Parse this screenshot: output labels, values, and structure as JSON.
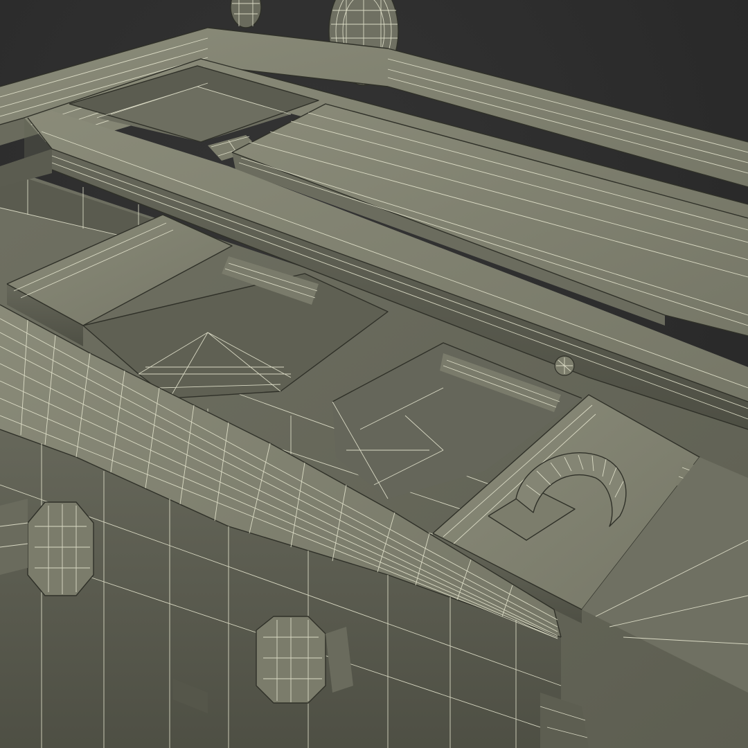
{
  "scene": {
    "background_color": "#2d2d2d",
    "mesh_color": "#7b7b6b",
    "mesh_shadow_color": "#55564a",
    "mesh_highlight_color": "#8a8b79",
    "wireframe_color": "#e6e6cf"
  }
}
